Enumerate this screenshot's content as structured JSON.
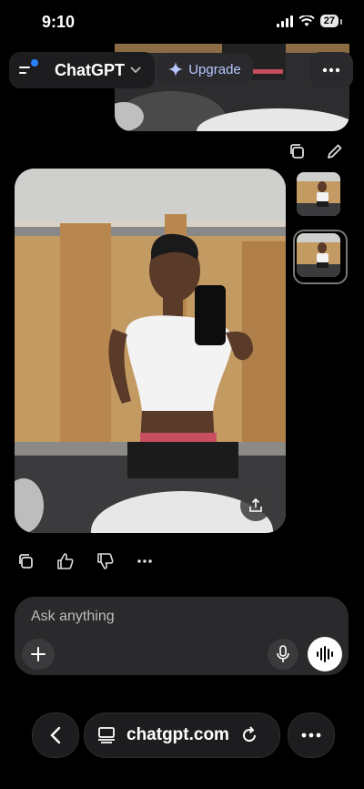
{
  "status": {
    "time": "9:10",
    "battery": "27"
  },
  "header": {
    "title": "ChatGPT",
    "upgrade_label": "Upgrade"
  },
  "composer": {
    "placeholder": "Ask anything"
  },
  "browser": {
    "url": "chatgpt.com"
  },
  "colors": {
    "accent_blue": "#2a82ff",
    "upgrade_text": "#b7c6ff"
  }
}
